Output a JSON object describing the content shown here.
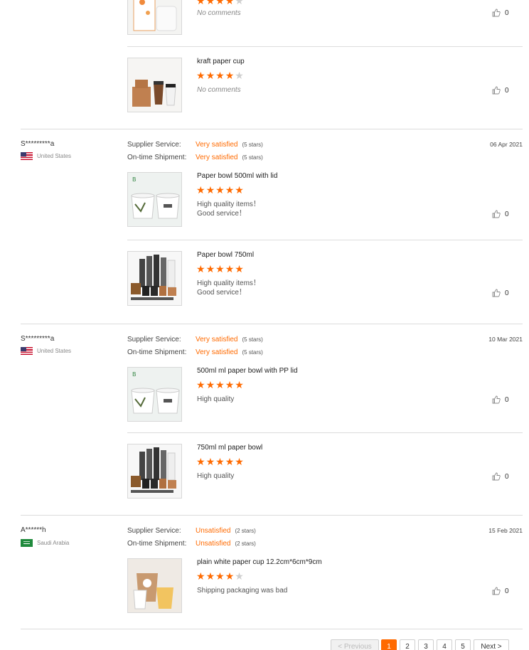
{
  "reviews": [
    {
      "items": [
        {
          "comment": "No comments",
          "stars_on": 4,
          "likes": "0"
        },
        {
          "name": "kraft paper cup",
          "comment": "No comments",
          "stars_on": 4,
          "likes": "0"
        }
      ]
    },
    {
      "reviewer": "S*********a",
      "country": "United States",
      "date": "06 Apr 2021",
      "supplier_label": "Supplier Service:",
      "supplier_value": "Very satisfied",
      "supplier_stars": "(5 stars)",
      "shipment_label": "On-time Shipment:",
      "shipment_value": "Very satisfied",
      "shipment_stars": "(5 stars)",
      "items": [
        {
          "name": "Paper bowl 500ml with lid",
          "comment": "High quality items！\nGood service！",
          "stars_on": 5,
          "likes": "0"
        },
        {
          "name": "Paper bowl 750ml",
          "comment": "High quality items！\nGood service！",
          "stars_on": 5,
          "likes": "0"
        }
      ]
    },
    {
      "reviewer": "S*********a",
      "country": "United States",
      "date": "10 Mar 2021",
      "supplier_label": "Supplier Service:",
      "supplier_value": "Very satisfied",
      "supplier_stars": "(5 stars)",
      "shipment_label": "On-time Shipment:",
      "shipment_value": "Very satisfied",
      "shipment_stars": "(5 stars)",
      "items": [
        {
          "name": "500ml ml paper bowl with PP lid",
          "comment": "High quality",
          "stars_on": 5,
          "likes": "0"
        },
        {
          "name": "750ml ml paper bowl",
          "comment": "High quality",
          "stars_on": 5,
          "likes": "0"
        }
      ]
    },
    {
      "reviewer": "A******h",
      "country": "Saudi Arabia",
      "date": "15 Feb 2021",
      "supplier_label": "Supplier Service:",
      "supplier_value": "Unsatisfied",
      "supplier_stars": "(2 stars)",
      "shipment_label": "On-time Shipment:",
      "shipment_value": "Unsatisfied",
      "shipment_stars": "(2 stars)",
      "items": [
        {
          "name": "plain white paper cup 12.2cm*6cm*9cm",
          "comment": "Shipping packaging was bad",
          "stars_on": 4,
          "likes": "0"
        }
      ]
    }
  ],
  "pagination": {
    "previous": "< Previous",
    "pages": [
      "1",
      "2",
      "3",
      "4",
      "5"
    ],
    "current": "1",
    "next": "Next >"
  },
  "colors": {
    "accent": "#ff6a00",
    "star_off": "#cfcfcf",
    "divider": "#dcdcdc"
  }
}
